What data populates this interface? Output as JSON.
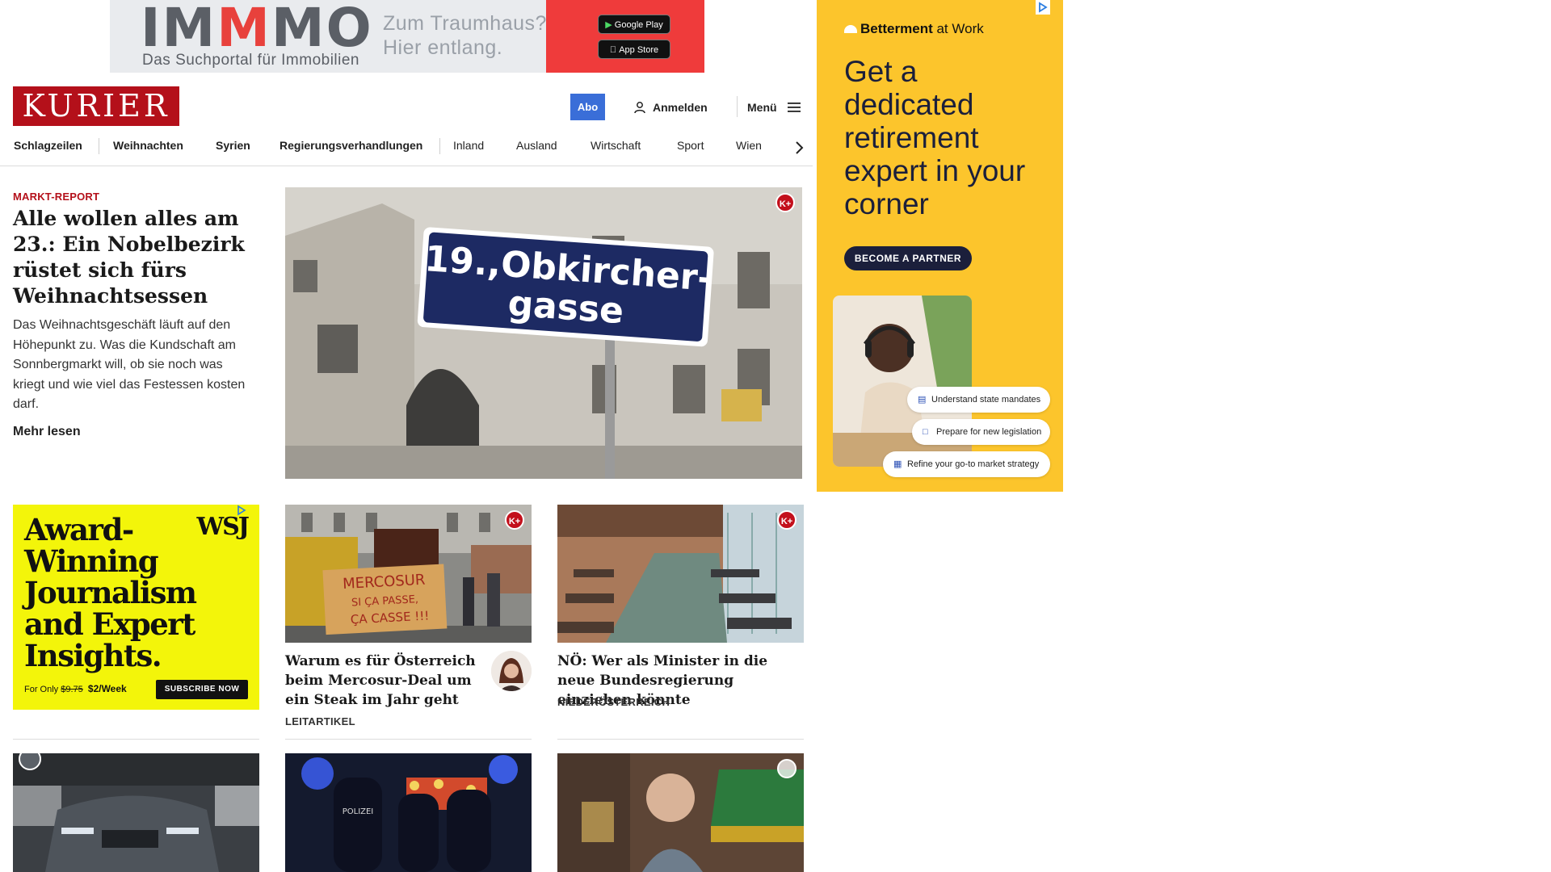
{
  "top_ad": {
    "logo": "IMMMO",
    "logo_m": "M",
    "tagline": "Das Suchportal für Immobilien",
    "claim_line1": "Zum Traumhaus?",
    "claim_line2": "Hier entlang.",
    "google_play": "Google Play",
    "app_store": "App Store"
  },
  "header": {
    "logo": "KURIER",
    "abo_label": "Abo",
    "login_label": "Anmelden",
    "menu_label": "Menü"
  },
  "nav": {
    "items": [
      "Schlagzeilen",
      "Weihnachten",
      "Syrien",
      "Regierungsverhandlungen",
      "Inland",
      "Ausland",
      "Wirtschaft",
      "Sport",
      "Wien"
    ]
  },
  "lead": {
    "kicker": "MARKT-REPORT",
    "title": "Alle wollen alles am 23.: Ein Nobelbezirk rüstet sich fürs Weihnachtsessen",
    "teaser": "Das Weihnachtsgeschäft läuft auf den Höhepunkt zu. Was die Kundschaft am Sonnbergmarkt will, ob sie noch was kriegt und wie viel das Festessen kosten darf.",
    "more": "Mehr lesen",
    "sign_line1": "19.,Obkircher-",
    "sign_line2": "gasse",
    "badge": "K+"
  },
  "right_ad": {
    "brand_bold": "Betterment",
    "brand_rest": " at Work",
    "headline": "Get a dedicated retirement expert in your corner",
    "cta": "BECOME A PARTNER",
    "pills": [
      "Understand state mandates",
      "Prepare for new legislation",
      "Refine your go-to market strategy"
    ]
  },
  "wsj_ad": {
    "headline": "Award-Winning Journalism and Expert Insights.",
    "logo": "WSJ",
    "price_prefix": "For Only ",
    "price_old": "$9.75",
    "price_new": "$2/Week",
    "cta": "SUBSCRIBE NOW"
  },
  "cards": [
    {
      "title": "Warum es für Österreich beim Mercosur-Deal um ein Steak im Jahr geht",
      "label": "LEITARTIKEL",
      "sign_line1": "MERCOSUR",
      "sign_line2": "SI ÇA PASSE,",
      "sign_line3": "ÇA CASSE !!!"
    },
    {
      "title": "NÖ: Wer als Minister in die neue Bundesregierung einziehen könnte",
      "label": "NIEDERÖSTERREICH"
    }
  ],
  "bottom_row": {
    "police_text": "POLIZEI"
  },
  "colors": {
    "brand_red": "#b4101a",
    "abo_blue": "#3a6ed8",
    "betterment_yellow": "#fcc52c",
    "wsj_yellow": "#f3f50a"
  }
}
